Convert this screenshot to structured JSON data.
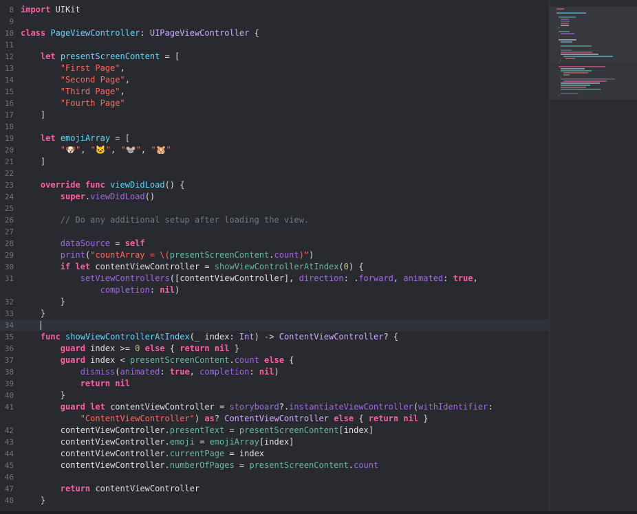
{
  "editor": {
    "lines": [
      {
        "n": "8",
        "html": "<span class=\"kw\">import</span> UIKit"
      },
      {
        "n": "9",
        "html": ""
      },
      {
        "n": "10",
        "html": "<span class=\"kw\">class</span> <span class=\"dcl\">PageViewController</span>: <span class=\"typ\">UIPageViewController</span> {"
      },
      {
        "n": "11",
        "html": ""
      },
      {
        "n": "12",
        "html": "    <span class=\"kw\">let</span> <span class=\"dcl\">presentScreenContent</span> = ["
      },
      {
        "n": "13",
        "html": "        <span class=\"str\">\"First Page\"</span>,"
      },
      {
        "n": "14",
        "html": "        <span class=\"str\">\"Second Page\"</span>,"
      },
      {
        "n": "15",
        "html": "        <span class=\"str\">\"Third Page\"</span>,"
      },
      {
        "n": "16",
        "html": "        <span class=\"str\">\"Fourth Page\"</span>"
      },
      {
        "n": "17",
        "html": "    ]"
      },
      {
        "n": "18",
        "html": ""
      },
      {
        "n": "19",
        "html": "    <span class=\"kw\">let</span> <span class=\"dcl\">emojiArray</span> = ["
      },
      {
        "n": "20",
        "html": "        <span class=\"str\">\"🐶\"</span>, <span class=\"str\">\"🐱\"</span>, <span class=\"str\">\"🐭\"</span>, <span class=\"str\">\"🐹\"</span>"
      },
      {
        "n": "21",
        "html": "    ]"
      },
      {
        "n": "22",
        "html": ""
      },
      {
        "n": "23",
        "html": "    <span class=\"kw\">override</span> <span class=\"kw\">func</span> <span class=\"dcl\">viewDidLoad</span>() {"
      },
      {
        "n": "24",
        "html": "        <span class=\"kw\">super</span>.<span class=\"bi\">viewDidLoad</span>()"
      },
      {
        "n": "25",
        "html": ""
      },
      {
        "n": "26",
        "html": "        <span class=\"cmt\">// Do any additional setup after loading the view.</span>"
      },
      {
        "n": "27",
        "html": ""
      },
      {
        "n": "28",
        "html": "        <span class=\"prp\">dataSource</span> = <span class=\"kw\">self</span>"
      },
      {
        "n": "29",
        "html": "        <span class=\"bi\">print</span>(<span class=\"str\">\"countArray = \\(</span><span class=\"fn\">presentScreenContent</span>.<span class=\"prp\">count</span><span class=\"str\">)\"</span>)"
      },
      {
        "n": "30",
        "html": "        <span class=\"kw\">if</span> <span class=\"kw\">let</span> contentViewController = <span class=\"fn\">showViewControllerAtIndex</span>(<span class=\"num\">0</span>) {"
      },
      {
        "n": "31",
        "html": "            <span class=\"bi\">setViewControllers</span>([contentViewController], <span class=\"bi\">direction</span>: .<span class=\"prp\">forward</span>, <span class=\"bi\">animated</span>: <span class=\"kw\">true</span>,"
      },
      {
        "n": "",
        "html": "                <span class=\"bi\">completion</span>: <span class=\"kw\">nil</span>)"
      },
      {
        "n": "32",
        "html": "        }"
      },
      {
        "n": "33",
        "html": "    }"
      },
      {
        "n": "34",
        "html": "    <span class=\"cursor\"></span>",
        "current": true
      },
      {
        "n": "35",
        "html": "    <span class=\"kw\">func</span> <span class=\"dcl\">showViewControllerAtIndex</span>(_ index: <span class=\"typ\">Int</span>) -&gt; <span class=\"typ\">ContentViewController</span>? {"
      },
      {
        "n": "36",
        "html": "        <span class=\"kw\">guard</span> index &gt;= <span class=\"num\">0</span> <span class=\"kw\">else</span> { <span class=\"kw\">return</span> <span class=\"kw\">nil</span> }"
      },
      {
        "n": "37",
        "html": "        <span class=\"kw\">guard</span> index &lt; <span class=\"fn\">presentScreenContent</span>.<span class=\"prp\">count</span> <span class=\"kw\">else</span> {"
      },
      {
        "n": "38",
        "html": "            <span class=\"bi\">dismiss</span>(<span class=\"bi\">animated</span>: <span class=\"kw\">true</span>, <span class=\"bi\">completion</span>: <span class=\"kw\">nil</span>)"
      },
      {
        "n": "39",
        "html": "            <span class=\"kw\">return</span> <span class=\"kw\">nil</span>"
      },
      {
        "n": "40",
        "html": "        }"
      },
      {
        "n": "41",
        "html": "        <span class=\"kw\">guard</span> <span class=\"kw\">let</span> contentViewController = <span class=\"prp\">storyboard</span>?.<span class=\"bi\">instantiateViewController</span>(<span class=\"bi\">withIdentifier</span>:"
      },
      {
        "n": "",
        "html": "            <span class=\"str\">\"ContentViewController\"</span>) <span class=\"kw\">as</span>? <span class=\"typ\">ContentViewController</span> <span class=\"kw\">else</span> { <span class=\"kw\">return</span> <span class=\"kw\">nil</span> }"
      },
      {
        "n": "42",
        "html": "        contentViewController.<span class=\"fn\">presentText</span> = <span class=\"fn\">presentScreenContent</span>[index]"
      },
      {
        "n": "43",
        "html": "        contentViewController.<span class=\"fn\">emoji</span> = <span class=\"fn\">emojiArray</span>[index]"
      },
      {
        "n": "44",
        "html": "        contentViewController.<span class=\"fn\">currentPage</span> = index"
      },
      {
        "n": "45",
        "html": "        contentViewController.<span class=\"fn\">numberOfPages</span> = <span class=\"fn\">presentScreenContent</span>.<span class=\"prp\">count</span>"
      },
      {
        "n": "46",
        "html": ""
      },
      {
        "n": "47",
        "html": "        <span class=\"kw\">return</span> contentViewController"
      },
      {
        "n": "48",
        "html": "    }"
      }
    ]
  },
  "colors": {
    "background": "#292a30",
    "keyword": "#fc5fa3",
    "string": "#fc6a5d",
    "number": "#d0bf69",
    "comment": "#6c7986",
    "type": "#d0a8ff",
    "declaration": "#5dd8ff",
    "project": "#67b7a4"
  }
}
